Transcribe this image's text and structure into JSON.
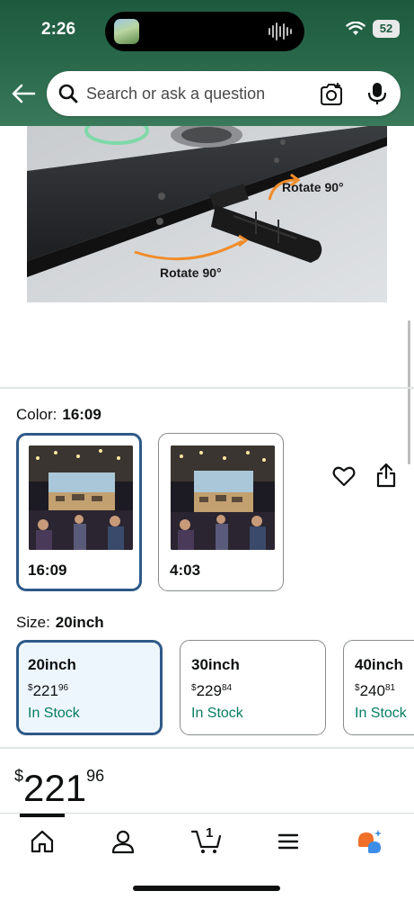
{
  "status_bar": {
    "time": "2:26",
    "battery": "52"
  },
  "search": {
    "placeholder": "Search or ask a question"
  },
  "product_image": {
    "annotations": [
      "Rotate 90°",
      "Rotate 90°"
    ],
    "carousel_dot_count": 5,
    "carousel_active_index": 3
  },
  "color": {
    "label": "Color:",
    "selected": "16:09",
    "options": [
      {
        "name": "16:09",
        "selected": true
      },
      {
        "name": "4:03",
        "selected": false
      }
    ]
  },
  "size": {
    "label": "Size:",
    "selected": "20inch",
    "options": [
      {
        "name": "20inch",
        "currency": "$",
        "whole": "221",
        "cents": "96",
        "stock": "In Stock",
        "selected": true
      },
      {
        "name": "30inch",
        "currency": "$",
        "whole": "229",
        "cents": "84",
        "stock": "In Stock",
        "selected": false
      },
      {
        "name": "40inch",
        "currency": "$",
        "whole": "240",
        "cents": "81",
        "stock": "In Stock",
        "selected": false
      }
    ]
  },
  "price": {
    "currency": "$",
    "whole": "221",
    "cents": "96"
  },
  "bottom_nav": {
    "cart_count": "1",
    "items": [
      "home-icon",
      "account-icon",
      "cart-icon",
      "menu-icon",
      "rufus-icon"
    ]
  },
  "colors": {
    "header_green": "#1d5a3e",
    "selected_border": "#2e5a88",
    "in_stock_green": "#067d62",
    "selected_bg": "#eef6fd"
  }
}
